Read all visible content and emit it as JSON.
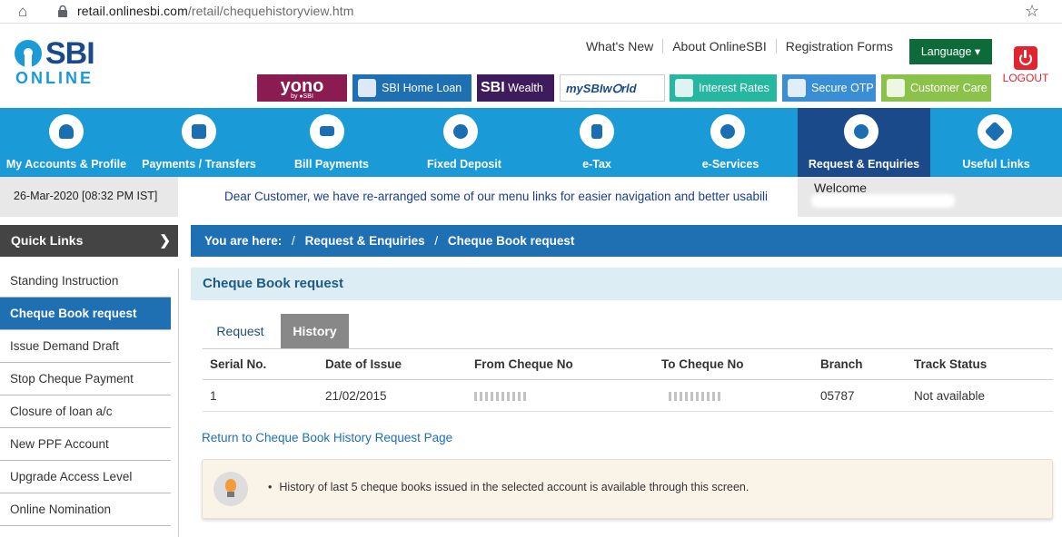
{
  "browser": {
    "url_host": "retail.onlinesbi.com",
    "url_path": "/retail/chequehistoryview.htm"
  },
  "header": {
    "logo_main": "SBI",
    "logo_sub": "ONLINE",
    "toplinks": [
      "What's New",
      "About OnlineSBI",
      "Registration Forms"
    ],
    "language_label": "Language ▾",
    "logout_label": "LOGOUT",
    "promos": {
      "yono": "yono",
      "yono_sub": "by ●SBI",
      "home_loan": "SBI Home Loan",
      "wealth_a": "SBI",
      "wealth_b": "Wealth",
      "sbiworld": "mySBIw⭘rld",
      "interest_rates": "Interest Rates",
      "secure_otp": "Secure OTP",
      "customer_care": "Customer Care"
    }
  },
  "nav": [
    {
      "label": "My Accounts & Profile",
      "icon": "user-icon"
    },
    {
      "label": "Payments / Transfers",
      "icon": "transfer-icon"
    },
    {
      "label": "Bill Payments",
      "icon": "bill-icon"
    },
    {
      "label": "Fixed Deposit",
      "icon": "deposit-icon"
    },
    {
      "label": "e-Tax",
      "icon": "tax-icon"
    },
    {
      "label": "e-Services",
      "icon": "pills-icon"
    },
    {
      "label": "Request & Enquiries",
      "icon": "phone-chat-icon",
      "active": true
    },
    {
      "label": "Useful Links",
      "icon": "links-icon"
    }
  ],
  "infobar": {
    "datetime": "26-Mar-2020 [08:32 PM IST]",
    "marquee": "Dear Customer, we have re-arranged some of our menu links for easier navigation and better usabili",
    "welcome": "Welcome"
  },
  "quicklinks": {
    "title": "Quick Links",
    "items": [
      {
        "label": "Standing Instruction"
      },
      {
        "label": "Cheque Book request",
        "active": true
      },
      {
        "label": "Issue Demand Draft"
      },
      {
        "label": "Stop Cheque Payment"
      },
      {
        "label": "Closure of loan a/c"
      },
      {
        "label": "New PPF Account"
      },
      {
        "label": "Upgrade Access Level"
      },
      {
        "label": "Online Nomination"
      }
    ]
  },
  "breadcrumb": {
    "prefix": "You are here:",
    "sep": "/",
    "level1": "Request & Enquiries",
    "level2": "Cheque Book request"
  },
  "panel": {
    "title": "Cheque Book request",
    "tabs": {
      "request": "Request",
      "history": "History"
    },
    "columns": [
      "Serial No.",
      "Date of Issue",
      "From Cheque No",
      "To Cheque No",
      "Branch",
      "Track Status"
    ],
    "rows": [
      {
        "serial": "1",
        "date": "21/02/2015",
        "branch": "05787",
        "status": "Not available"
      }
    ],
    "return_link": "Return to Cheque Book History Request Page",
    "note": "History of last 5 cheque books issued in the selected account is available through this screen."
  },
  "colors": {
    "brand_blue": "#1a9ad6",
    "nav_active": "#1a4a8a",
    "breadcrumb": "#1f6fb3"
  }
}
